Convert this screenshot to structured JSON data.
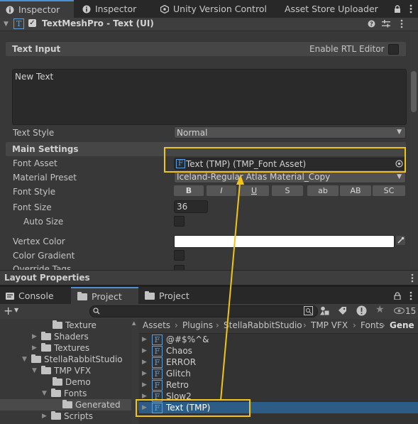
{
  "tabs": [
    {
      "label": "Inspector",
      "icon": "info-icon"
    },
    {
      "label": "Inspector",
      "icon": "info-icon"
    },
    {
      "label": "Unity Version Control",
      "icon": "version-control-icon"
    },
    {
      "label": "Asset Store Uploader",
      "icon": ""
    }
  ],
  "component": {
    "title": "TextMeshPro - Text (UI)",
    "text_input_section": "Text Input",
    "enable_rtl_label": "Enable RTL Editor",
    "text_value": "New Text",
    "text_style_label": "Text Style",
    "text_style_value": "Normal",
    "main_settings_section": "Main Settings",
    "font_asset_label": "Font Asset",
    "font_asset_value": "Text (TMP) (TMP_Font Asset)",
    "material_preset_label": "Material Preset",
    "material_preset_value": "Iceland-Regular Atlas Material_Copy",
    "font_style_label": "Font Style",
    "font_style_buttons": [
      "B",
      "I",
      "U",
      "S",
      "ab",
      "AB",
      "SC"
    ],
    "font_size_label": "Font Size",
    "font_size_value": "36",
    "auto_size_label": "Auto Size",
    "vertex_color_label": "Vertex Color",
    "vertex_color": "#ffffff",
    "color_gradient_label": "Color Gradient",
    "override_tags_label": "Override Tags"
  },
  "layout_properties": "Layout Properties",
  "bottom_tabs": [
    {
      "label": "Console"
    },
    {
      "label": "Project"
    },
    {
      "label": "Project"
    }
  ],
  "hidden_count": "15",
  "tree": [
    {
      "label": "Texture"
    },
    {
      "label": "Shaders"
    },
    {
      "label": "Textures"
    },
    {
      "label": "StellaRabbitStudio"
    },
    {
      "label": "TMP VFX"
    },
    {
      "label": "Demo"
    },
    {
      "label": "Fonts"
    },
    {
      "label": "Generated"
    },
    {
      "label": "Scripts"
    }
  ],
  "breadcrumb": [
    "Assets",
    "Plugins",
    "StellaRabbitStudio",
    "TMP VFX",
    "Fonts",
    "Gene"
  ],
  "assets": [
    {
      "label": "@#$%^&"
    },
    {
      "label": "Chaos"
    },
    {
      "label": "ERROR"
    },
    {
      "label": "Glitch"
    },
    {
      "label": "Retro"
    },
    {
      "label": "Slow2"
    },
    {
      "label": "Text (TMP)"
    }
  ],
  "colors": {
    "accent": "#4d8ed8",
    "highlight": "#f0c419",
    "selection": "#2c5d87"
  }
}
